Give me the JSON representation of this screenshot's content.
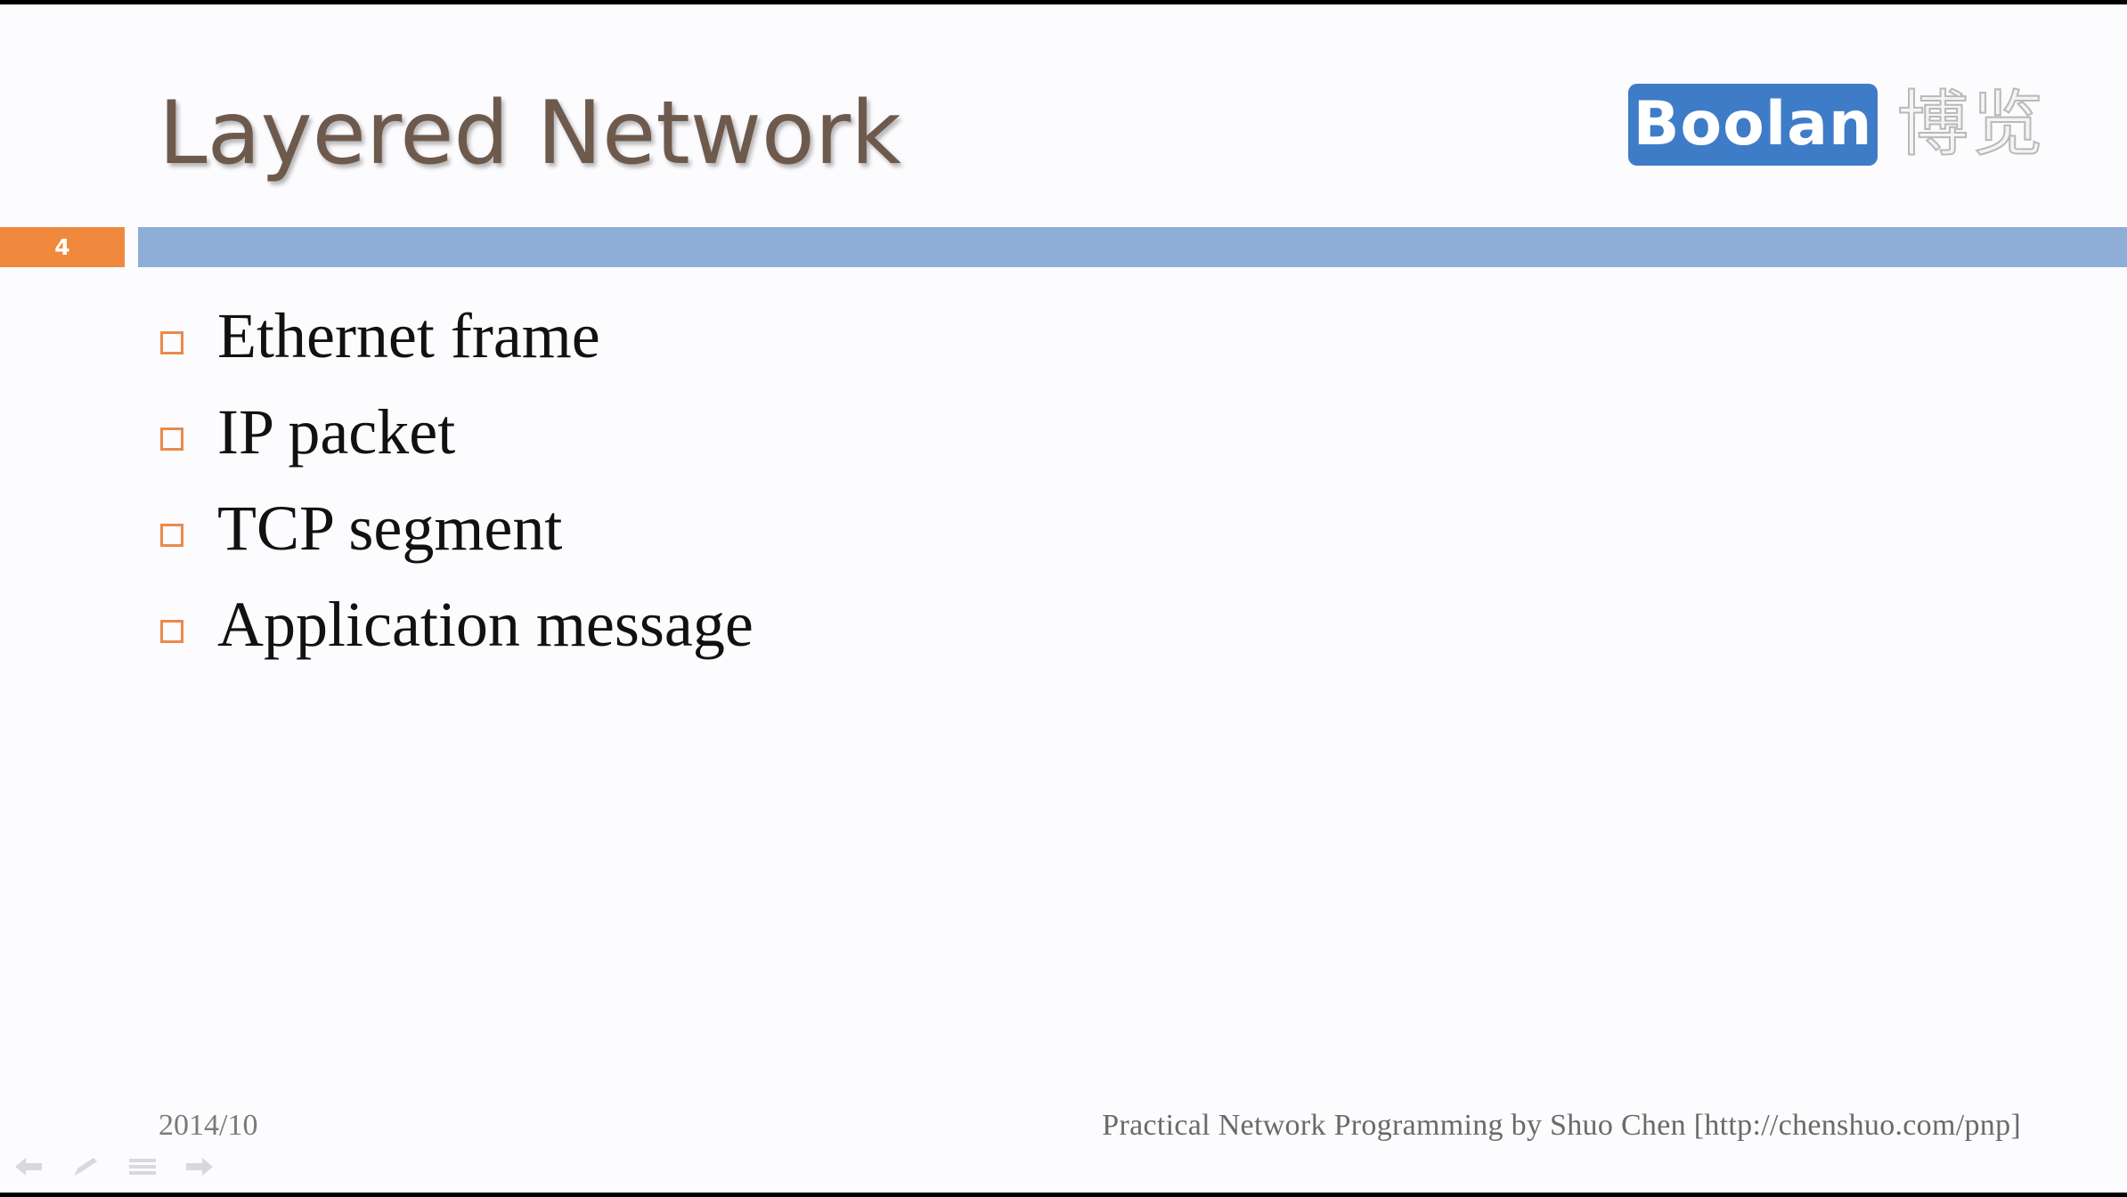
{
  "slide": {
    "title": "Layered Network",
    "number": "4",
    "logo": {
      "text": "Boolan",
      "chinese": "博览"
    },
    "bullets": [
      "Ethernet frame",
      "IP packet",
      "TCP segment",
      "Application message"
    ],
    "footer": {
      "date": "2014/10",
      "credit": "Practical Network Programming by Shuo Chen [http://chenshuo.com/pnp]"
    }
  },
  "nav_tools": [
    {
      "name": "previous-slide-icon"
    },
    {
      "name": "pen-icon"
    },
    {
      "name": "slide-menu-icon"
    },
    {
      "name": "next-slide-icon"
    }
  ],
  "colors": {
    "title": "#6e5a4d",
    "accent_orange": "#f0893e",
    "band_blue": "#8eaed8",
    "logo_blue": "#3f7cc8",
    "background": "#fcfbfd"
  }
}
